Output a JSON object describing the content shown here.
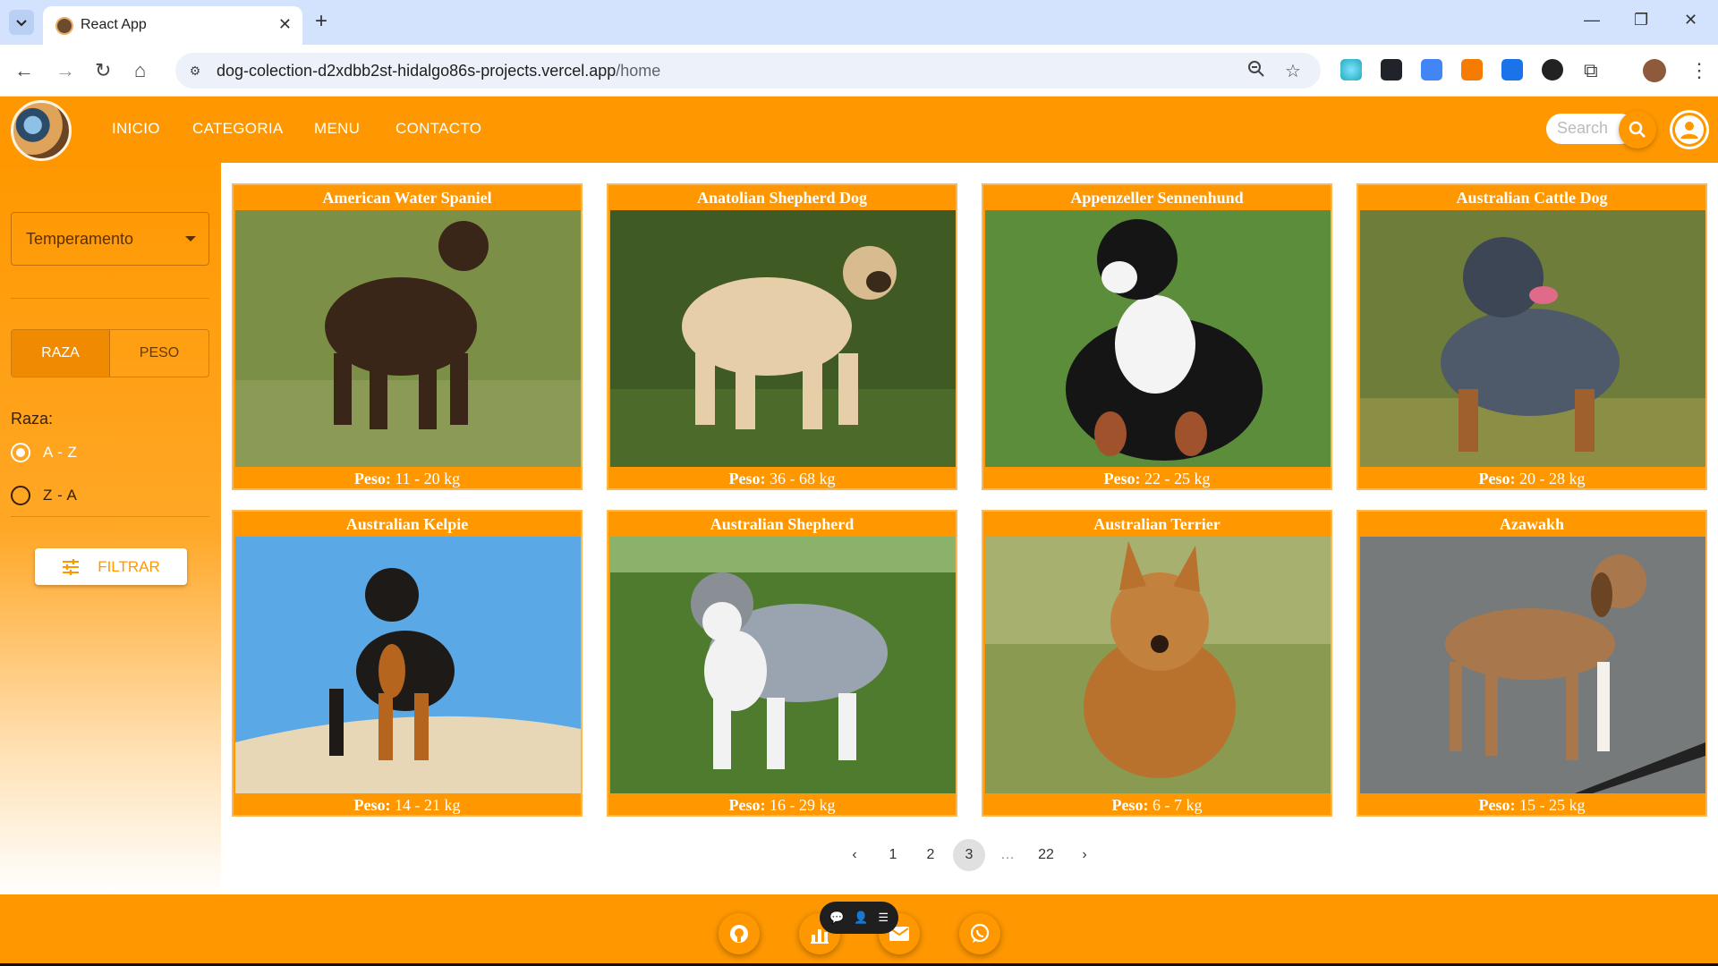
{
  "browser": {
    "tab_title": "React App",
    "url_host": "dog-colection-d2xdbb2st-hidalgo86s-projects.vercel.app",
    "url_path": "/home"
  },
  "header": {
    "nav": [
      "INICIO",
      "CATEGORIA",
      "MENU",
      "CONTACTO"
    ],
    "search_placeholder": "Search",
    "accent_color": "#ff9800"
  },
  "sidebar": {
    "temperament_label": "Temperamento",
    "sort_tabs": [
      "RAZA",
      "PESO"
    ],
    "active_sort_tab": "RAZA",
    "raza_label": "Raza:",
    "order_options": [
      "A - Z",
      "Z - A"
    ],
    "selected_order": "A - Z",
    "filter_button": "FILTRAR"
  },
  "cards": [
    {
      "name": "American Water Spaniel",
      "peso_label": "Peso:",
      "peso": "11 - 20 kg"
    },
    {
      "name": "Anatolian Shepherd Dog",
      "peso_label": "Peso:",
      "peso": "36 - 68 kg"
    },
    {
      "name": "Appenzeller Sennenhund",
      "peso_label": "Peso:",
      "peso": "22 - 25 kg"
    },
    {
      "name": "Australian Cattle Dog",
      "peso_label": "Peso:",
      "peso": "20 - 28 kg"
    },
    {
      "name": "Australian Kelpie",
      "peso_label": "Peso:",
      "peso": "14 - 21 kg"
    },
    {
      "name": "Australian Shepherd",
      "peso_label": "Peso:",
      "peso": "16 - 29 kg"
    },
    {
      "name": "Australian Terrier",
      "peso_label": "Peso:",
      "peso": "6 - 7 kg"
    },
    {
      "name": "Azawakh",
      "peso_label": "Peso:",
      "peso": "15 - 25 kg"
    }
  ],
  "pagination": {
    "prev": "‹",
    "pages": [
      "1",
      "2",
      "3"
    ],
    "current": "3",
    "ellipsis": "…",
    "last": "22",
    "next": "›"
  },
  "footer": {
    "icons": [
      "github-icon",
      "chart-icon",
      "mail-icon",
      "whatsapp-icon"
    ]
  }
}
